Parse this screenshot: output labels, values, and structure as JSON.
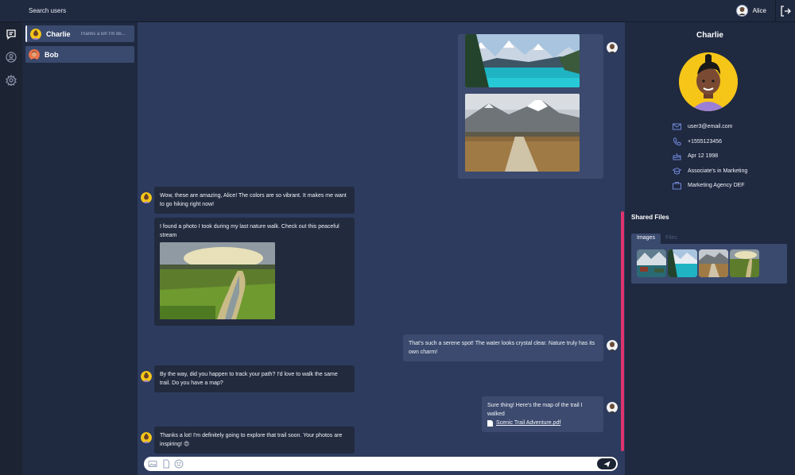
{
  "topbar": {
    "search_label": "Search users",
    "current_user": "Alice"
  },
  "contacts": [
    {
      "name": "Charlie",
      "preview": "Thanks a lot! I'm de...",
      "active": true
    },
    {
      "name": "Bob",
      "preview": "",
      "active": false
    }
  ],
  "messages": [
    {
      "from": "Alice",
      "type": "images",
      "images": [
        "turquoise-mountain-lake",
        "mountain-boardwalk-trail"
      ]
    },
    {
      "from": "Charlie",
      "type": "text",
      "text": "Wow, these are amazing, Alice! The colors are so vibrant. It makes me want to go hiking right now!"
    },
    {
      "from": "Charlie",
      "type": "text-image",
      "text": "I found a photo I took during my last nature walk. Check out this peaceful stream",
      "image": "meadow-stream"
    },
    {
      "from": "Alice",
      "type": "text",
      "text": "That's such a serene spot! The water looks crystal clear. Nature truly has its own charm!"
    },
    {
      "from": "Charlie",
      "type": "text",
      "text": "By the way, did you happen to track your path? I'd love to walk the same trail. Do you have a map?"
    },
    {
      "from": "Alice",
      "type": "file",
      "text": "Sure thing! Here's the map of the trail I walked",
      "file_name": "Scenic Trail Adventure.pdf"
    },
    {
      "from": "Charlie",
      "type": "text",
      "text": "Thanks a lot! I'm definitely going to explore that trail soon. Your photos are inspiring! 😍"
    }
  ],
  "composer": {
    "icons": [
      "image-icon",
      "file-icon",
      "emoji-icon"
    ],
    "send_icon": "send-icon"
  },
  "profile": {
    "name": "Charlie",
    "email": "user3@email.com",
    "phone": "+1555123456",
    "birthday": "Apr 12 1998",
    "education": "Associate's in Marketing",
    "work": "Marketing Agency DEF"
  },
  "shared_files": {
    "title": "Shared Files",
    "tabs": [
      "Images",
      "Files"
    ],
    "active_tab": "Images",
    "images": [
      "mountain-lake-cabin",
      "turquoise-mountain-lake",
      "mountain-boardwalk-trail",
      "meadow-stream"
    ]
  },
  "colors": {
    "accent_scroll": "#e0336c",
    "profile_avatar_bg": "#f5c518"
  }
}
